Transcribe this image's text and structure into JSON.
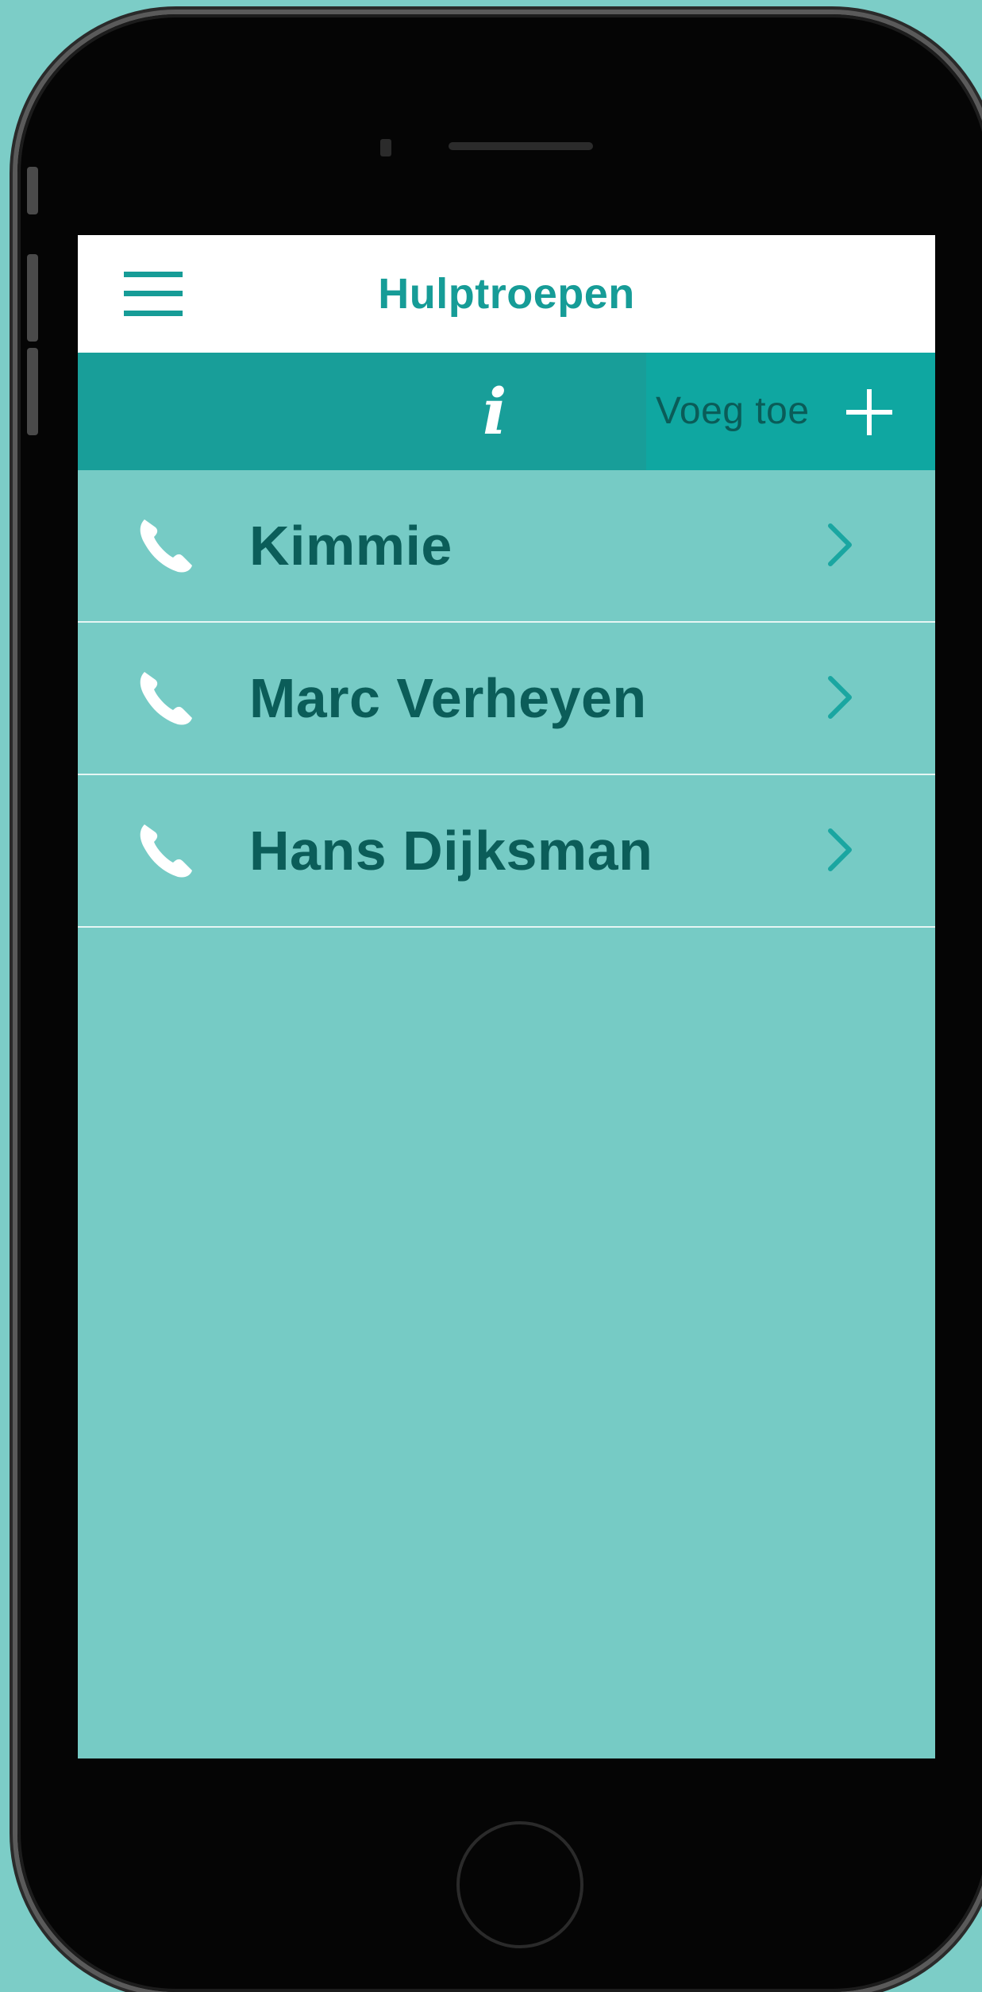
{
  "header": {
    "title": "Hulptroepen",
    "menu_icon": "hamburger-menu-icon"
  },
  "toolbar": {
    "info_icon": "info-icon",
    "info_glyph": "i",
    "add_label": "Voeg toe",
    "add_icon": "plus-icon"
  },
  "contacts": [
    {
      "name": "Kimmie",
      "icon": "phone-icon",
      "action_icon": "chevron-right-icon"
    },
    {
      "name": "Marc Verheyen",
      "icon": "phone-icon",
      "action_icon": "chevron-right-icon"
    },
    {
      "name": "Hans Dijksman",
      "icon": "phone-icon",
      "action_icon": "chevron-right-icon"
    }
  ],
  "colors": {
    "background": "#7ccdc7",
    "accent": "#169c97",
    "toolbar": "#189e99",
    "add_button": "#0fa7a1",
    "list_bg": "#76cbc5",
    "name_text": "#0b5d59"
  }
}
